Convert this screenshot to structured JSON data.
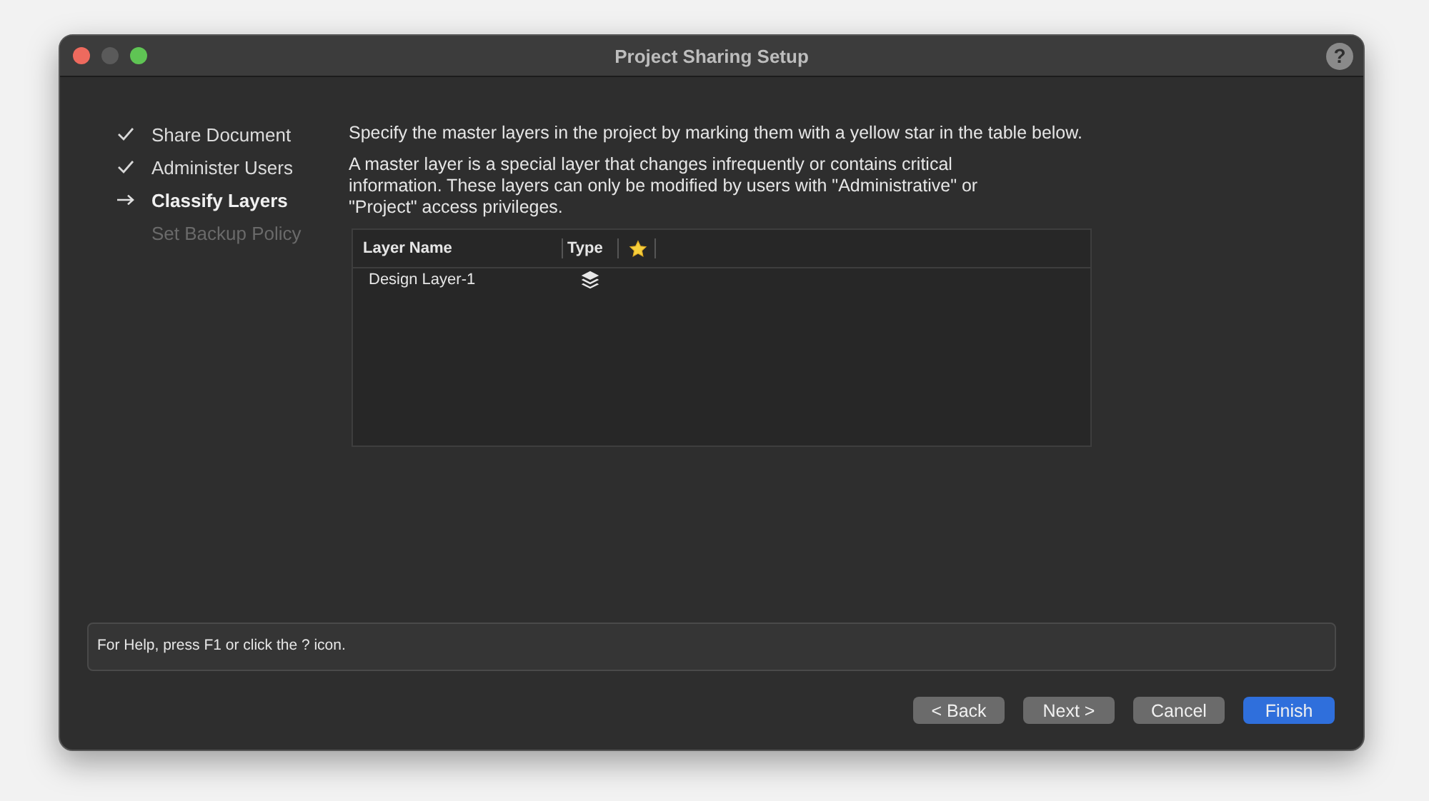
{
  "window": {
    "title": "Project Sharing Setup",
    "help": "?"
  },
  "steps": [
    {
      "label": "Share Document",
      "completed": true,
      "current": false
    },
    {
      "label": "Administer Users",
      "completed": true,
      "current": false
    },
    {
      "label": "Classify Layers",
      "completed": false,
      "current": true
    },
    {
      "label": "Set Backup Policy",
      "completed": false,
      "current": false
    }
  ],
  "instructions": [
    "Specify the master layers in the project by marking them with a yellow star in the table below.",
    "A master layer is a special layer that changes infrequently or contains critical information. These layers can only be modified by users with \"Administrative\" or \"Project\" access privileges."
  ],
  "table": {
    "columns": [
      {
        "label": "Layer Name",
        "kind": "text"
      },
      {
        "label": "Type",
        "kind": "text"
      },
      {
        "kind": "star"
      }
    ],
    "rows": [
      {
        "name": "Design Layer-1",
        "master": false
      }
    ]
  },
  "help_text": "For Help, press F1 or click the ? icon.",
  "buttons": [
    {
      "label": "< Back",
      "default": false
    },
    {
      "label": "Next >",
      "default": false
    },
    {
      "label": "Cancel",
      "default": false
    },
    {
      "label": "Finish",
      "default": true
    }
  ]
}
